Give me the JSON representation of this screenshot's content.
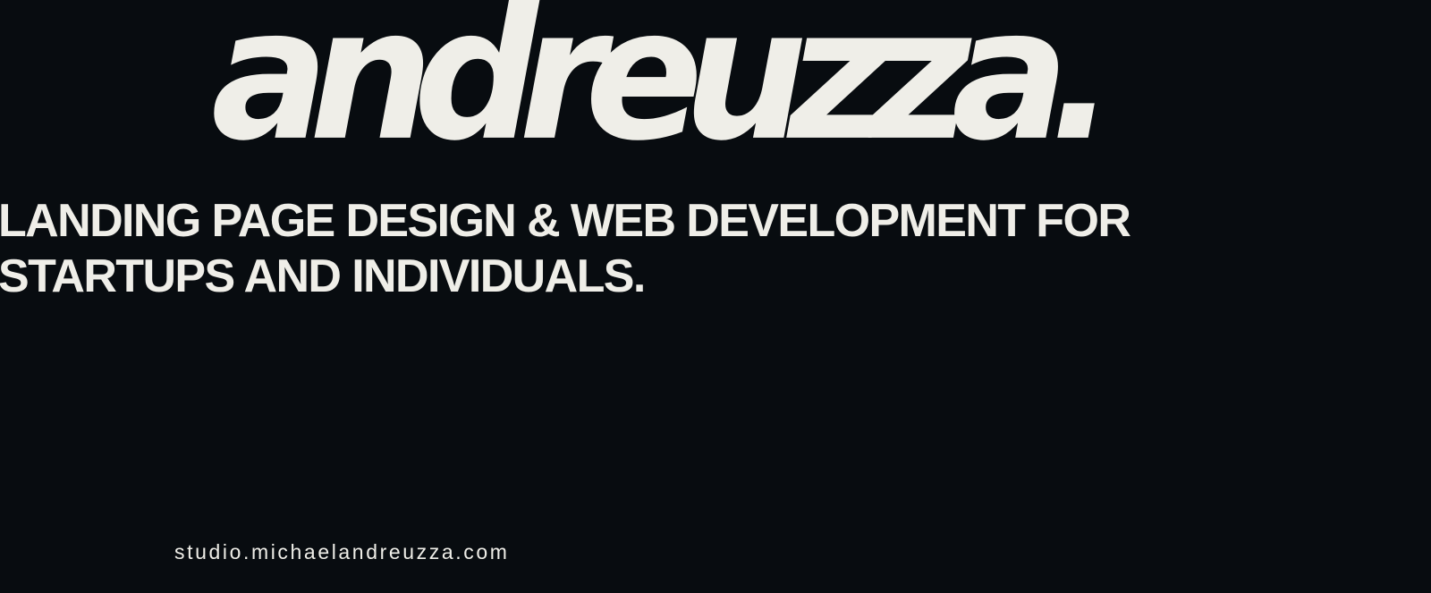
{
  "brand": {
    "logo_text": "andreuzza."
  },
  "hero": {
    "tagline_line1": "LANDING PAGE DESIGN & WEB DEVELOPMENT FOR",
    "tagline_line2": "STARTUPS AND INDIVIDUALS."
  },
  "footer": {
    "url_text": "studio.michaelandreuzza.com"
  },
  "colors": {
    "background": "#080c10",
    "text": "#efeee8"
  }
}
